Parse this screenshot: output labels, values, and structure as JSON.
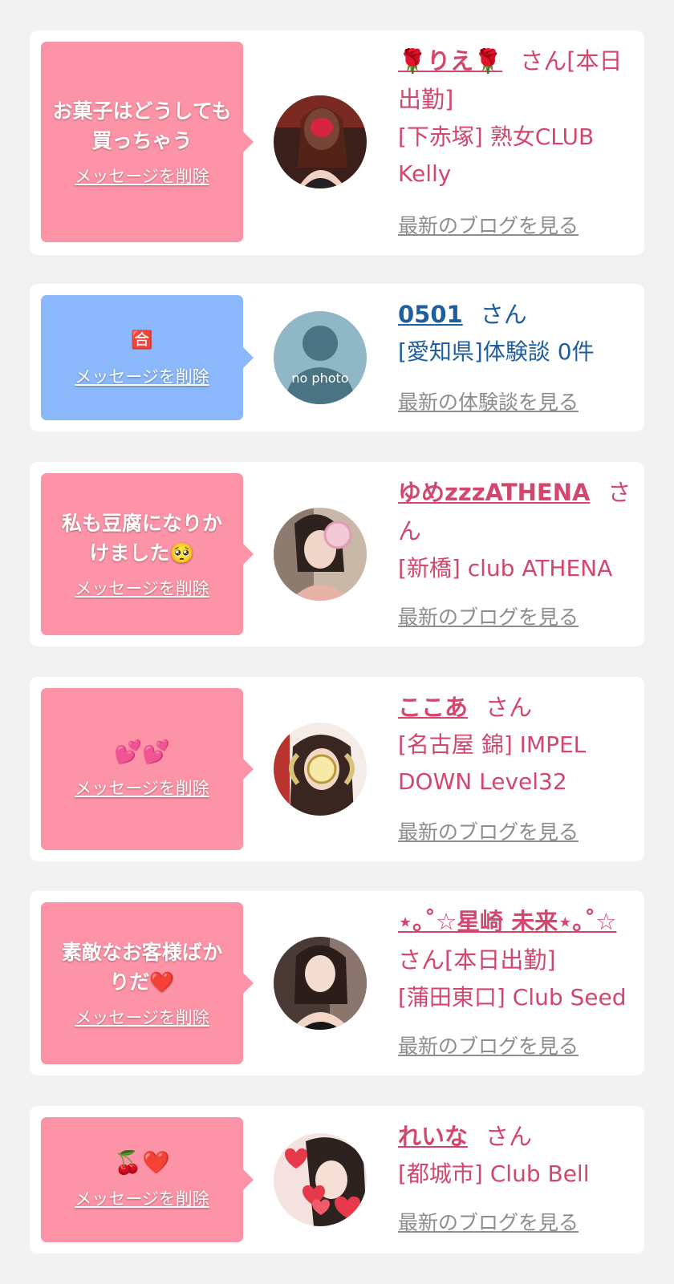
{
  "delete_label": "メッセージを削除",
  "cards": [
    {
      "message": "お菓子はどうしても買っちゃう",
      "name": "🌹りえ🌹",
      "suffix": "さん[本日出勤]",
      "shop": "[下赤塚] 熟女CLUB Kelly",
      "link": "最新のブログを見る"
    },
    {
      "message": "",
      "emoji": "🈴",
      "name": "0501",
      "suffix": "さん",
      "shop": "[愛知県]体験談 0件",
      "link": "最新の体験談を見る",
      "avatar_text": "no photo"
    },
    {
      "message": "私も豆腐になりかけました🥺",
      "name": "ゆめzzzATHENA",
      "suffix": "さん",
      "shop": "[新橋] club ATHENA",
      "link": "最新のブログを見る"
    },
    {
      "message": "",
      "emoji": "💕💕",
      "name": "ここあ",
      "suffix": "さん",
      "shop": "[名古屋 錦] IMPEL DOWN Level32",
      "link": "最新のブログを見る"
    },
    {
      "message": "素敵なお客様ばかりだ❤️",
      "name": "⋆｡˚☆星崎 未来⋆｡˚☆",
      "suffix": "さん[本日出勤]",
      "shop": "[蒲田東口] Club Seed",
      "link": "最新のブログを見る"
    },
    {
      "message": "",
      "emoji": "🍒❤️",
      "name": "れいな",
      "suffix": "さん",
      "shop": "[都城市] Club Bell",
      "link": "最新のブログを見る"
    }
  ],
  "colors": {
    "page_bg": "#f2f2f2",
    "pink_bubble": "#fd93a6",
    "blue_bubble": "#8ab8fb",
    "pink_text": "#d2476d",
    "blue_text": "#1f5e9e",
    "link_gray": "#8d8d8d"
  }
}
